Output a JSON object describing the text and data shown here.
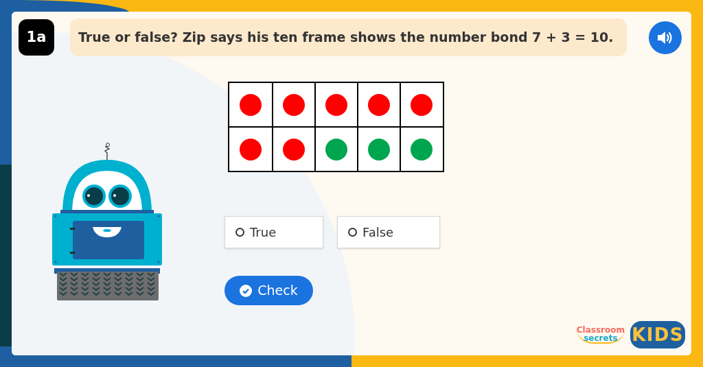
{
  "question_number": "1a",
  "question": "True or false? Zip says his ten frame shows the number bond 7 + 3 = 10.",
  "ten_frame": {
    "rows": [
      {
        "cells": [
          {
            "color": "#ff0000"
          },
          {
            "color": "#ff0000"
          },
          {
            "color": "#ff0000"
          },
          {
            "color": "#ff0000"
          },
          {
            "color": "#ff0000"
          }
        ]
      },
      {
        "cells": [
          {
            "color": "#ff0000"
          },
          {
            "color": "#ff0000"
          },
          {
            "color": "#00a64f"
          },
          {
            "color": "#00a64f"
          },
          {
            "color": "#00a64f"
          }
        ]
      }
    ]
  },
  "options": [
    {
      "label": "True",
      "selected": false
    },
    {
      "label": "False",
      "selected": false
    }
  ],
  "check_button": "Check",
  "logo": {
    "line_1": "Classroom",
    "line_2": "secrets",
    "badge": "KIDS"
  }
}
